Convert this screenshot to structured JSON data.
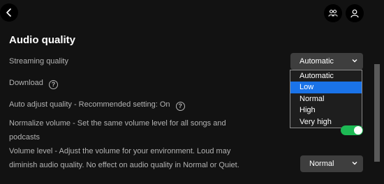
{
  "header": {
    "back_icon": "chevron-left-icon",
    "friends_icon": "friends-icon",
    "profile_icon": "user-icon"
  },
  "section": {
    "title": "Audio quality"
  },
  "streaming": {
    "label": "Streaming quality",
    "selected": "Automatic",
    "options": [
      "Automatic",
      "Low",
      "Normal",
      "High",
      "Very high"
    ],
    "highlighted_option": "Low"
  },
  "download": {
    "label": "Download"
  },
  "auto_adjust": {
    "label": "Auto adjust quality - Recommended setting: On"
  },
  "normalize": {
    "label": "Normalize volume - Set the same volume level for all songs and podcasts",
    "enabled": true
  },
  "volume_level": {
    "label": "Volume level - Adjust the volume for your environment. Loud may diminish audio quality. No effect on audio quality in Normal or Quiet.",
    "selected": "Normal"
  },
  "colors": {
    "background": "#121212",
    "accent_green": "#1db954",
    "highlight_blue": "#1a73e8"
  }
}
